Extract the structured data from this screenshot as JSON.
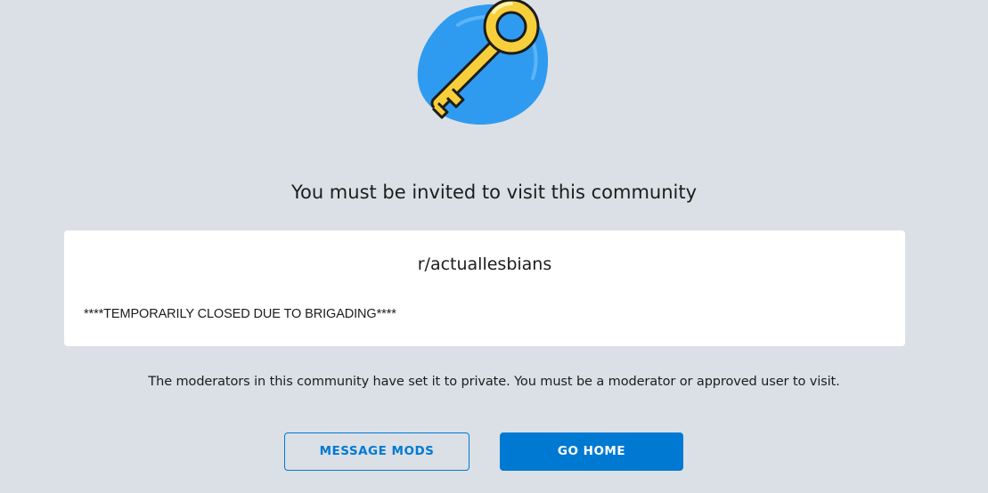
{
  "illustration": {
    "icon": "key-icon",
    "colors": {
      "blob": "#2f9bf0",
      "key_fill": "#f7cf3a",
      "key_outline": "#1c1c1c"
    }
  },
  "headline": "You must be invited to visit this community",
  "card": {
    "community_name": "r/actuallesbians",
    "description": "****TEMPORARILY CLOSED DUE TO BRIGADING****"
  },
  "explanation": "The moderators in this community have set it to private. You must be a moderator or approved user to visit.",
  "buttons": {
    "message_mods": "MESSAGE MODS",
    "go_home": "GO HOME"
  },
  "colors": {
    "page_background": "#dae0e6",
    "accent": "#0079d3",
    "card_background": "#ffffff",
    "text": "#1c1c1c"
  }
}
